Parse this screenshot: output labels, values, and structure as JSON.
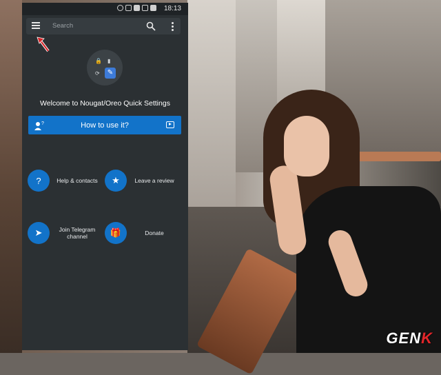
{
  "status_bar": {
    "time": "18:13"
  },
  "search": {
    "placeholder": "Search"
  },
  "welcome": {
    "title": "Welcome to Nougat/Oreo Quick Settings"
  },
  "howto": {
    "label": "How to use it?"
  },
  "actions": [
    {
      "label": "Help & contacts",
      "icon": "question-icon"
    },
    {
      "label": "Leave a review",
      "icon": "star-icon"
    },
    {
      "label": "Join Telegram channel",
      "icon": "telegram-icon"
    },
    {
      "label": "Donate",
      "icon": "gift-icon"
    }
  ],
  "watermark": {
    "left": "GEN",
    "right": "K"
  },
  "colors": {
    "app_background": "#2b3033",
    "accent_blue": "#1273c9",
    "arrow_red": "#d7262a"
  }
}
